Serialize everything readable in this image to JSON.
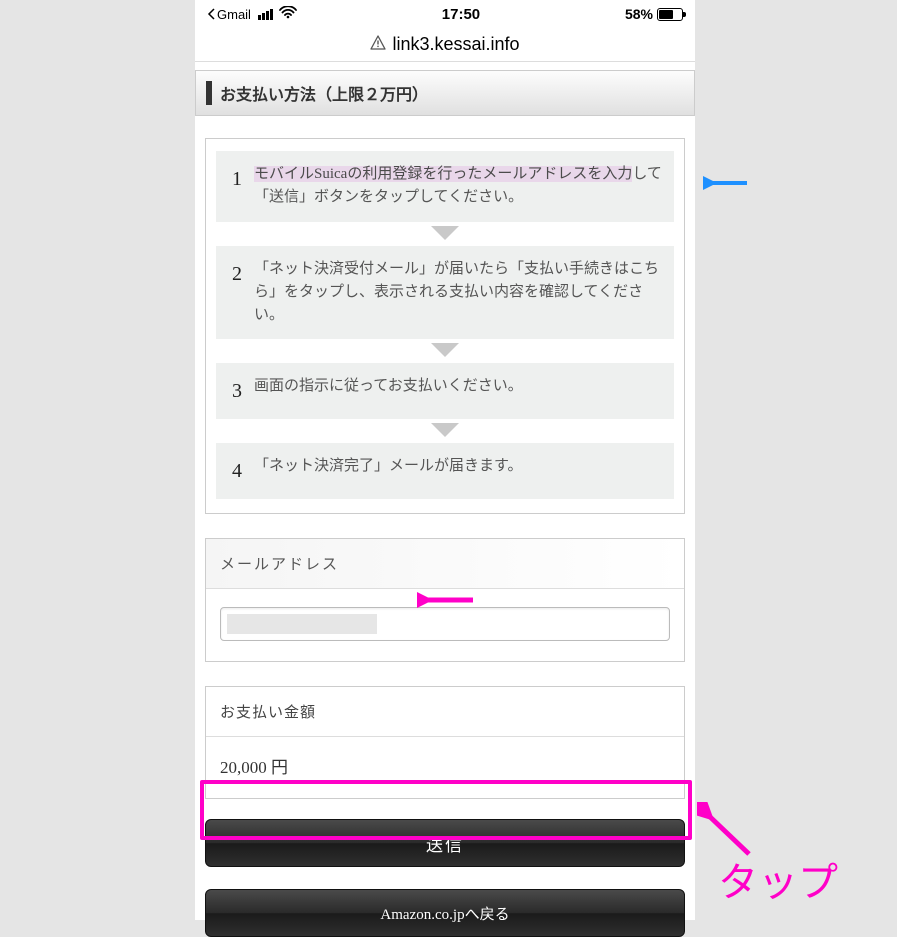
{
  "status_bar": {
    "back_app": "Gmail",
    "time": "17:50",
    "battery_pct": "58%"
  },
  "url_bar": {
    "domain": "link3.kessai.info"
  },
  "payment_method": {
    "title": "お支払い方法（上限２万円）"
  },
  "steps": [
    {
      "n": "1",
      "text_hl": "モバイルSuicaの利用登録を行ったメールアドレスを入力",
      "text_rest": "して「送信」ボタンをタップしてください。"
    },
    {
      "n": "2",
      "text": "「ネット決済受付メール」が届いたら「支払い手続きはこちら」をタップし、表示される支払い内容を確認してください。"
    },
    {
      "n": "3",
      "text": "画面の指示に従ってお支払いください。"
    },
    {
      "n": "4",
      "text": "「ネット決済完了」メールが届きます。"
    }
  ],
  "email_section": {
    "label": "メールアドレス"
  },
  "amount_section": {
    "label": "お支払い金額",
    "value": "20,000 円"
  },
  "buttons": {
    "submit": "送信",
    "back": "Amazon.co.jpへ戻る"
  },
  "annotations": {
    "tap_label": "タップ"
  }
}
